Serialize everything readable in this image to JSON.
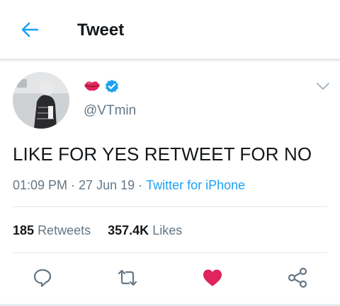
{
  "header": {
    "title": "Tweet",
    "back_icon": "arrow-left-icon"
  },
  "tweet": {
    "handle": "@VTmin",
    "name_emoji": "kiss-mark-icon",
    "verified_icon": "verified-badge-icon",
    "text": "LIKE FOR YES RETWEET FOR NO",
    "time": "01:09 PM",
    "date": "27 Jun 19",
    "source": "Twitter for iPhone"
  },
  "stats": {
    "retweets_count": "185",
    "retweets_label": "Retweets",
    "likes_count": "357.4K",
    "likes_label": "Likes"
  },
  "actions": [
    "reply-icon",
    "retweet-icon",
    "like-icon",
    "share-icon"
  ],
  "colors": {
    "accent": "#1da1f2",
    "like": "#e0245e",
    "text_secondary": "#657786",
    "text_primary": "#14171a",
    "divider": "#e1e8ed"
  }
}
